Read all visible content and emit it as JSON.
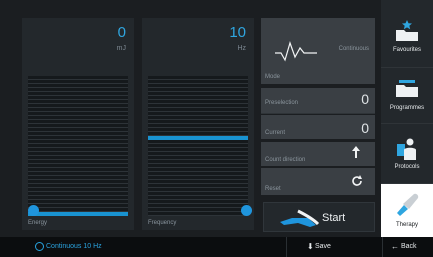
{
  "energy": {
    "value": "0",
    "unit": "mJ",
    "label": "Energy",
    "level_fraction": 0.0
  },
  "frequency": {
    "value": "10",
    "unit": "Hz",
    "label": "Frequency",
    "level_fraction": 0.48
  },
  "mode": {
    "label": "Mode",
    "caption": "Continuous"
  },
  "preselection": {
    "label": "Preselection",
    "value": "0"
  },
  "current": {
    "label": "Current",
    "value": "0"
  },
  "count_direction": {
    "label": "Count direction",
    "icon": "arrow-up-icon"
  },
  "reset": {
    "label": "Reset",
    "icon": "refresh-icon"
  },
  "start_button": {
    "label": "Start"
  },
  "sidebar": {
    "items": [
      {
        "label": "Favourites",
        "icon": "favourites-folder-icon"
      },
      {
        "label": "Programmes",
        "icon": "programmes-folder-icon"
      },
      {
        "label": "Protocols",
        "icon": "protocols-person-icon"
      },
      {
        "label": "Therapy",
        "icon": "therapy-applicator-icon"
      }
    ]
  },
  "status_bar": {
    "mode_text": "Continuous 10 Hz",
    "save_label": "Save",
    "back_label": "Back"
  },
  "colors": {
    "accent": "#1f95dd",
    "panel": "#23282c",
    "tile": "#3a3f44",
    "background": "#1b1e21"
  }
}
